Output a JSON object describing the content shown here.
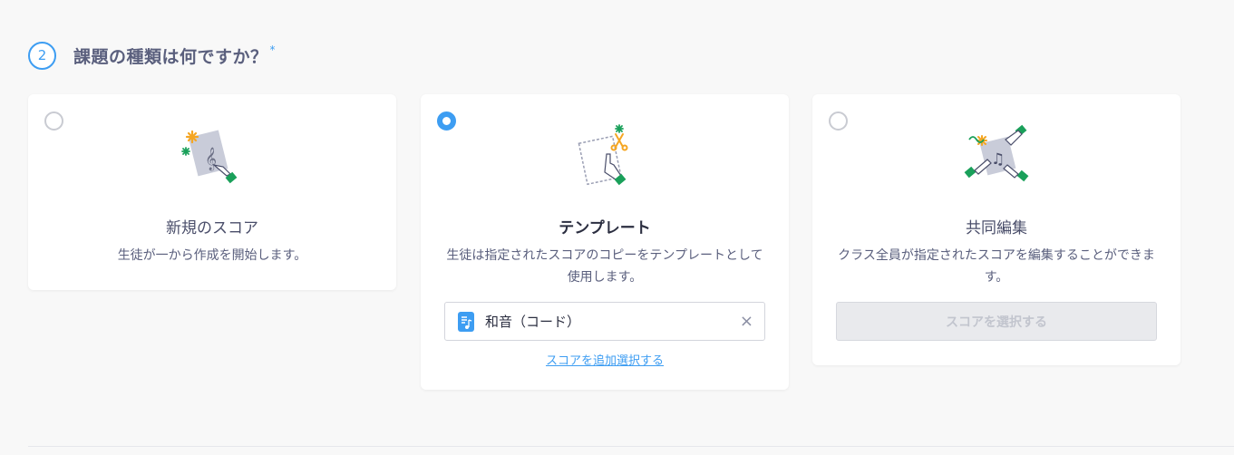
{
  "step": {
    "number": "2",
    "title": "課題の種類は何ですか？",
    "required_mark": "*"
  },
  "options": [
    {
      "title": "新規のスコア",
      "description": "生徒が一から作成を開始します。",
      "selected": false,
      "icon": "new-score-illustration"
    },
    {
      "title": "テンプレート",
      "description": "生徒は指定されたスコアのコピーをテンプレートとして使用します。",
      "selected": true,
      "icon": "template-illustration",
      "selected_score": "和音（コード）",
      "add_link": "スコアを追加選択する"
    },
    {
      "title": "共同編集",
      "description": "クラス全員が指定されたスコアを編集することができます。",
      "selected": false,
      "icon": "collaborate-illustration",
      "button": "スコアを選択する"
    }
  ],
  "colors": {
    "accent": "#3d9df2",
    "green": "#1aa05a",
    "orange": "#f5a623",
    "paper": "#c9ccd9"
  }
}
